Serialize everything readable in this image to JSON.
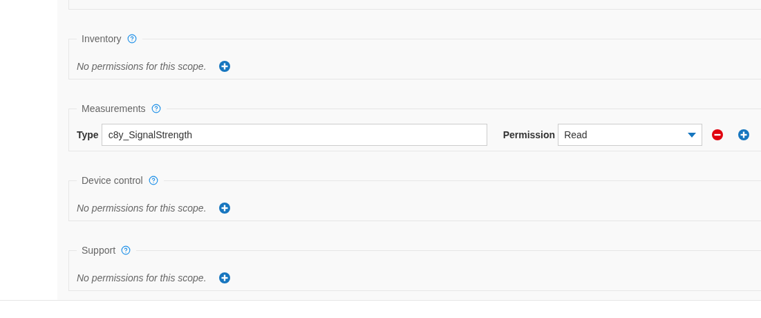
{
  "sections": [
    {
      "title": "Inventory",
      "kind": "empty",
      "message": "No permissions for this scope."
    },
    {
      "title": "Measurements",
      "kind": "rows",
      "rows": [
        {
          "type_label": "Type",
          "type_value": "c8y_SignalStrength",
          "permission_label": "Permission",
          "permission_value": "Read"
        }
      ]
    },
    {
      "title": "Device control",
      "kind": "empty",
      "message": "No permissions for this scope."
    },
    {
      "title": "Support",
      "kind": "empty",
      "message": "No permissions for this scope."
    }
  ]
}
